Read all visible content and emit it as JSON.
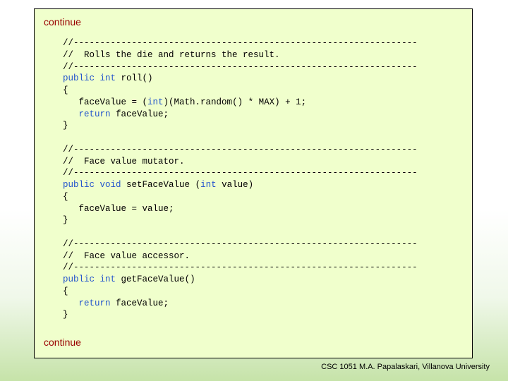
{
  "slide": {
    "top_label": "continue",
    "bottom_label": "continue",
    "footer": "CSC 1051 M.A. Papalaskari, Villanova University"
  },
  "code": [
    [
      {
        "t": "//-----------------------------------------------------------------"
      }
    ],
    [
      {
        "t": "//  Rolls the die and returns the result."
      }
    ],
    [
      {
        "t": "//-----------------------------------------------------------------"
      }
    ],
    [
      {
        "t": "public",
        "k": true
      },
      {
        "t": " "
      },
      {
        "t": "int",
        "k": true
      },
      {
        "t": " roll()"
      }
    ],
    [
      {
        "t": "{"
      }
    ],
    [
      {
        "t": "   faceValue = ("
      },
      {
        "t": "int",
        "k": true
      },
      {
        "t": ")(Math.random() * MAX) + 1;"
      }
    ],
    [
      {
        "t": "   "
      },
      {
        "t": "return",
        "k": true
      },
      {
        "t": " faceValue;"
      }
    ],
    [
      {
        "t": "}"
      }
    ],
    [
      {
        "t": ""
      }
    ],
    [
      {
        "t": "//-----------------------------------------------------------------"
      }
    ],
    [
      {
        "t": "//  Face value mutator."
      }
    ],
    [
      {
        "t": "//-----------------------------------------------------------------"
      }
    ],
    [
      {
        "t": "public",
        "k": true
      },
      {
        "t": " "
      },
      {
        "t": "void",
        "k": true
      },
      {
        "t": " setFaceValue ("
      },
      {
        "t": "int",
        "k": true
      },
      {
        "t": " value)"
      }
    ],
    [
      {
        "t": "{"
      }
    ],
    [
      {
        "t": "   faceValue = value;"
      }
    ],
    [
      {
        "t": "}"
      }
    ],
    [
      {
        "t": ""
      }
    ],
    [
      {
        "t": "//-----------------------------------------------------------------"
      }
    ],
    [
      {
        "t": "//  Face value accessor."
      }
    ],
    [
      {
        "t": "//-----------------------------------------------------------------"
      }
    ],
    [
      {
        "t": "public",
        "k": true
      },
      {
        "t": " "
      },
      {
        "t": "int",
        "k": true
      },
      {
        "t": " getFaceValue()"
      }
    ],
    [
      {
        "t": "{"
      }
    ],
    [
      {
        "t": "   "
      },
      {
        "t": "return",
        "k": true
      },
      {
        "t": " faceValue;"
      }
    ],
    [
      {
        "t": "}"
      }
    ]
  ]
}
